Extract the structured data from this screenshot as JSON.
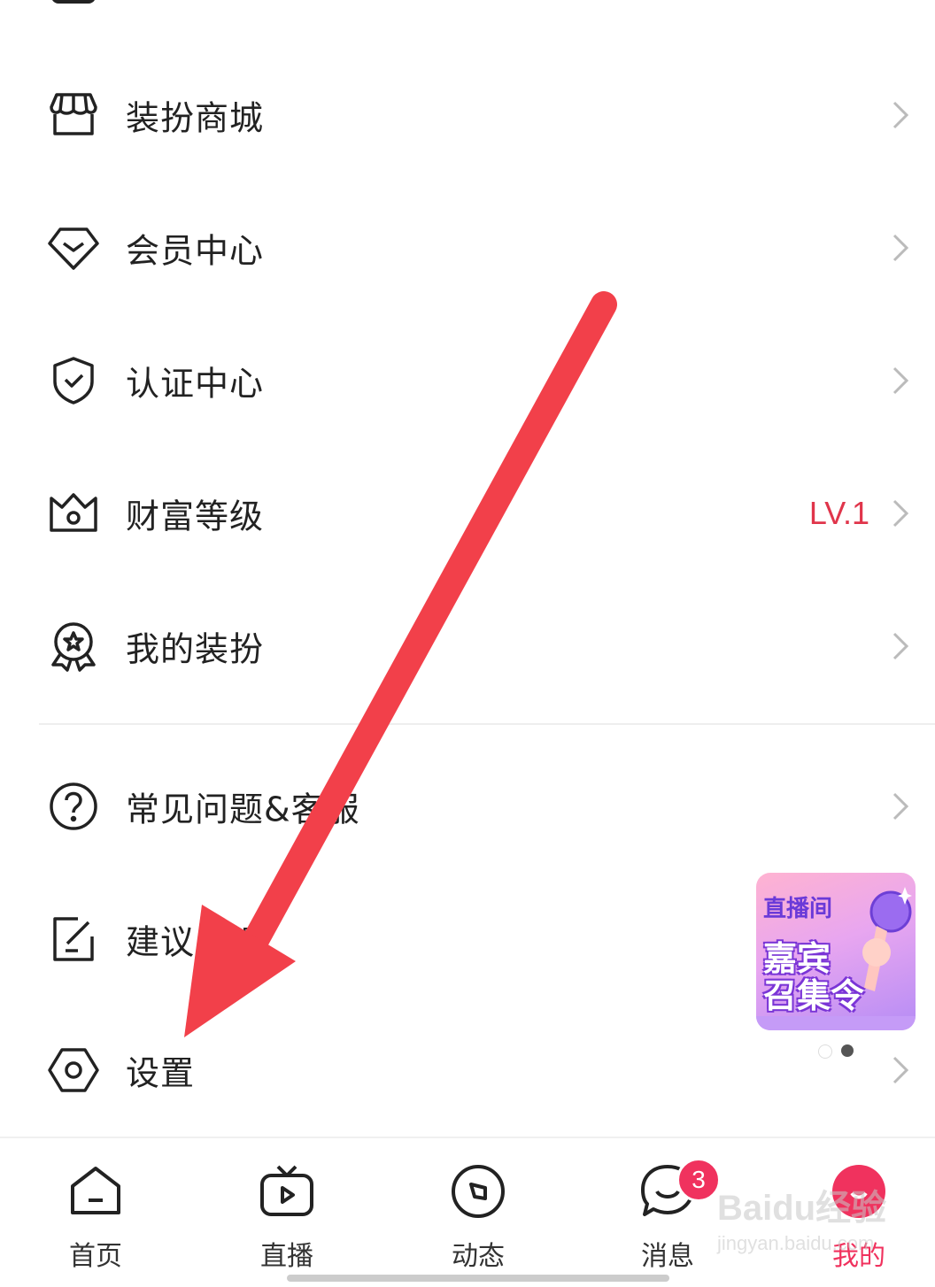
{
  "menu": {
    "items": [
      {
        "label": "装扮商城",
        "icon": "store-icon"
      },
      {
        "label": "会员中心",
        "icon": "diamond-icon"
      },
      {
        "label": "认证中心",
        "icon": "shield-check-icon"
      },
      {
        "label": "财富等级",
        "icon": "crown-icon",
        "value": "LV.1"
      },
      {
        "label": "我的装扮",
        "icon": "badge-icon"
      },
      {
        "label": "常见问题&客服",
        "icon": "question-icon"
      },
      {
        "label": "建议反馈",
        "icon": "edit-icon"
      },
      {
        "label": "设置",
        "icon": "settings-hexagon-icon"
      }
    ]
  },
  "banner": {
    "line1": "直播间",
    "line2": "嘉宾",
    "line3": "召集令"
  },
  "tabbar": {
    "tabs": [
      {
        "label": "首页",
        "icon": "home-icon"
      },
      {
        "label": "直播",
        "icon": "tv-icon"
      },
      {
        "label": "动态",
        "icon": "compass-icon"
      },
      {
        "label": "消息",
        "icon": "chat-icon",
        "badge": "3"
      },
      {
        "label": "我的",
        "icon": "profile-icon",
        "active": true
      }
    ]
  },
  "watermark": {
    "brand": "Baidu经验",
    "url": "jingyan.baidu.com"
  },
  "colors": {
    "accent": "#f0325e",
    "level_text": "#e0354b",
    "arrow": "#f2404a"
  }
}
